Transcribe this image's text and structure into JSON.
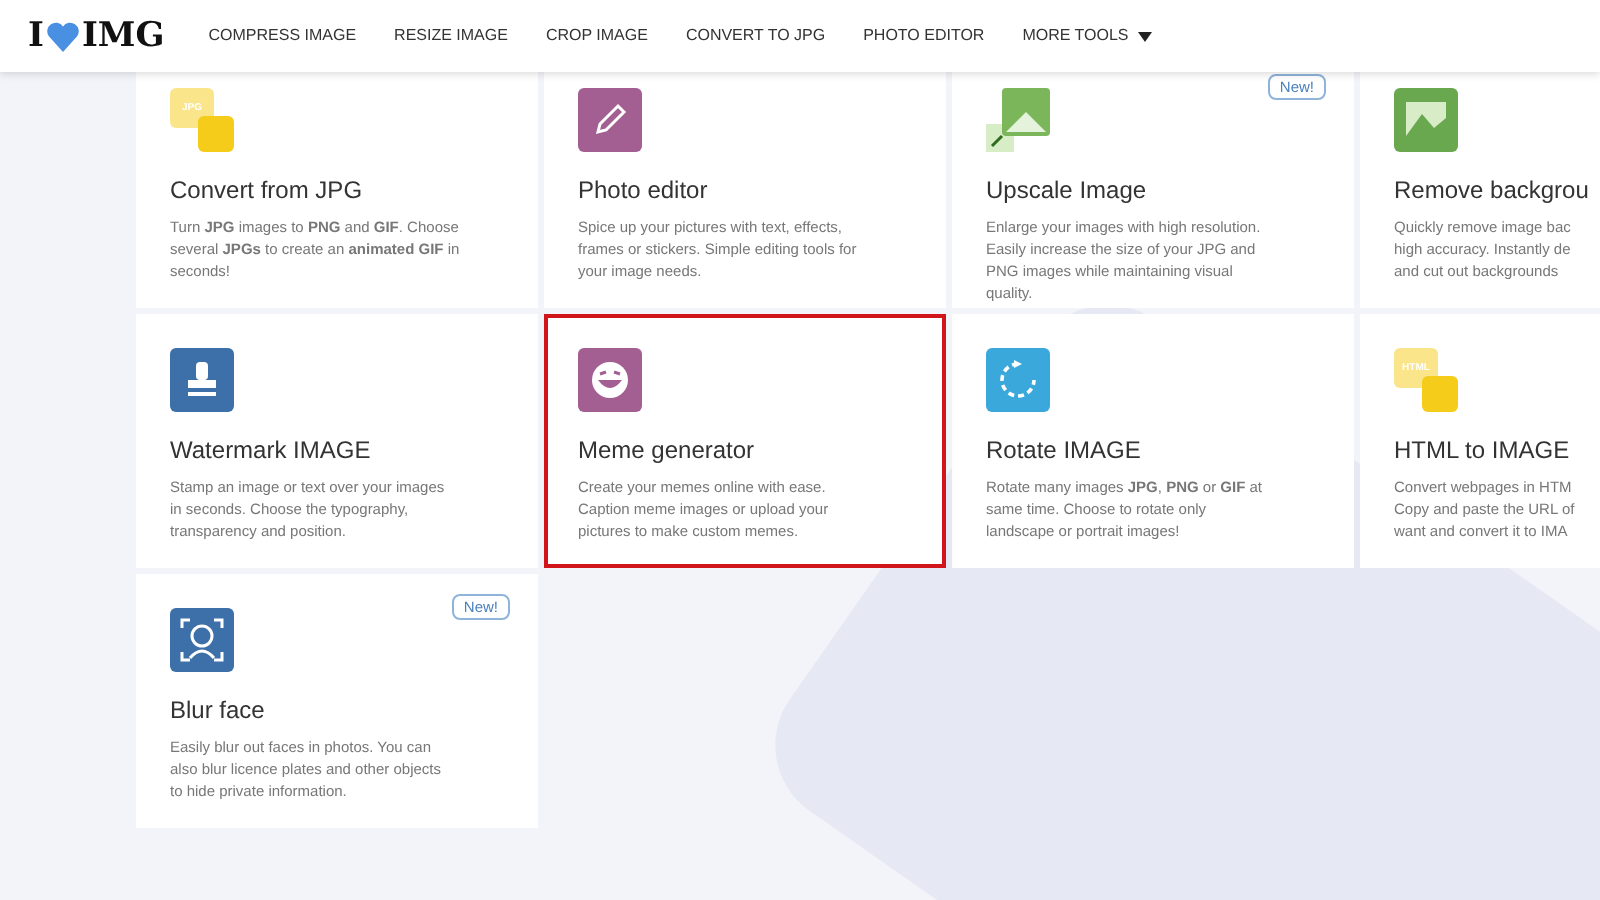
{
  "header": {
    "logo_left": "I",
    "logo_right": "IMG",
    "nav": [
      {
        "label": "COMPRESS IMAGE"
      },
      {
        "label": "RESIZE IMAGE"
      },
      {
        "label": "CROP IMAGE"
      },
      {
        "label": "CONVERT TO JPG"
      },
      {
        "label": "PHOTO EDITOR"
      },
      {
        "label": "MORE TOOLS",
        "dropdown": true
      }
    ]
  },
  "tools": [
    {
      "kind": "jpg",
      "title": "Convert from JPG",
      "icon_label": "JPG",
      "highlighted": false,
      "lines": [
        "Turn **JPG** images to **PNG** and **GIF**. Choose",
        "several **JPGs** to create an **animated GIF** in",
        "seconds!"
      ]
    },
    {
      "kind": "edit",
      "title": "Photo editor",
      "highlighted": false,
      "lines": [
        "Spice up your pictures with text, effects,",
        "frames or stickers. Simple editing tools for",
        "your image needs."
      ]
    },
    {
      "kind": "upscale",
      "title": "Upscale Image",
      "badge": "New!",
      "highlighted": false,
      "lines": [
        "Enlarge your images with high resolution.",
        "Easily increase the size of your JPG and",
        "PNG images while maintaining visual",
        "quality."
      ]
    },
    {
      "kind": "removebg",
      "title": "Remove backgrou",
      "highlighted": false,
      "lines": [
        "Quickly remove image bac",
        "high accuracy. Instantly de",
        "and cut out backgrounds"
      ]
    },
    {
      "kind": "watermark",
      "title": "Watermark IMAGE",
      "highlighted": false,
      "lines": [
        "Stamp an image or text over your images",
        "in seconds. Choose the typography,",
        "transparency and position."
      ]
    },
    {
      "kind": "meme",
      "title": "Meme generator",
      "highlighted": true,
      "lines": [
        "Create your memes online with ease.",
        "Caption meme images or upload your",
        "pictures to make custom memes."
      ]
    },
    {
      "kind": "rotate",
      "title": "Rotate IMAGE",
      "highlighted": false,
      "lines": [
        "Rotate many images **JPG**, **PNG** or **GIF** at",
        "same time. Choose to rotate only",
        "landscape or portrait images!"
      ]
    },
    {
      "kind": "html",
      "title": "HTML to IMAGE",
      "icon_label": "HTML",
      "highlighted": false,
      "lines": [
        "Convert webpages in HTM",
        "Copy and paste the URL of",
        "want and convert it to IMA"
      ]
    },
    {
      "kind": "blur",
      "title": "Blur face",
      "badge": "New!",
      "highlighted": false,
      "lines": [
        "Easily blur out faces in photos. You can",
        "also blur licence plates and other objects",
        "to hide private information."
      ]
    }
  ]
}
